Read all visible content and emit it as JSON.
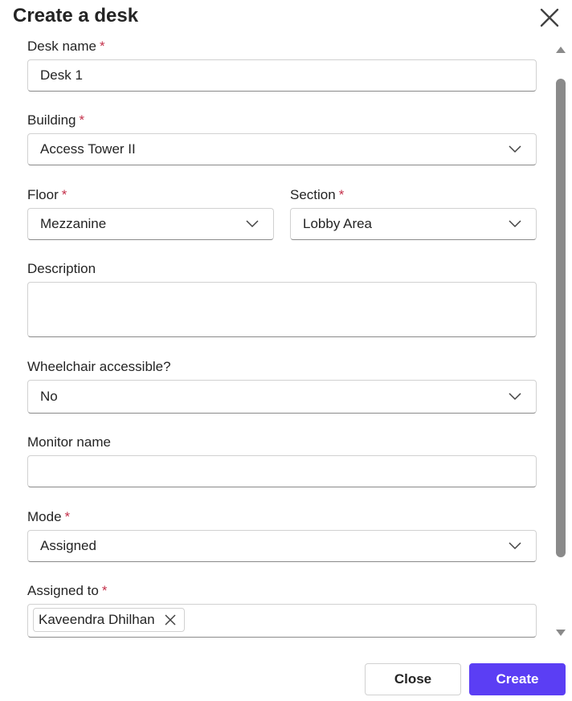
{
  "dialog": {
    "title": "Create a desk",
    "required_mark": "*"
  },
  "fields": {
    "desk_name": {
      "label": "Desk name",
      "value": "Desk 1"
    },
    "building": {
      "label": "Building",
      "value": "Access Tower II"
    },
    "floor": {
      "label": "Floor",
      "value": "Mezzanine"
    },
    "section": {
      "label": "Section",
      "value": "Lobby Area"
    },
    "description": {
      "label": "Description",
      "value": ""
    },
    "wheelchair": {
      "label": "Wheelchair accessible?",
      "value": "No"
    },
    "monitor_name": {
      "label": "Monitor name",
      "value": ""
    },
    "mode": {
      "label": "Mode",
      "value": "Assigned"
    },
    "assigned_to": {
      "label": "Assigned to",
      "people": [
        "Kaveendra Dhilhan"
      ]
    }
  },
  "footer": {
    "close_label": "Close",
    "create_label": "Create"
  },
  "colors": {
    "accent": "#5b3ef4",
    "required": "#c4314b",
    "border": "#d1d1d1"
  },
  "icons": [
    "close-icon",
    "chevron-down-icon",
    "dismiss-chip-icon",
    "scroll-up-arrow",
    "scroll-down-arrow"
  ]
}
